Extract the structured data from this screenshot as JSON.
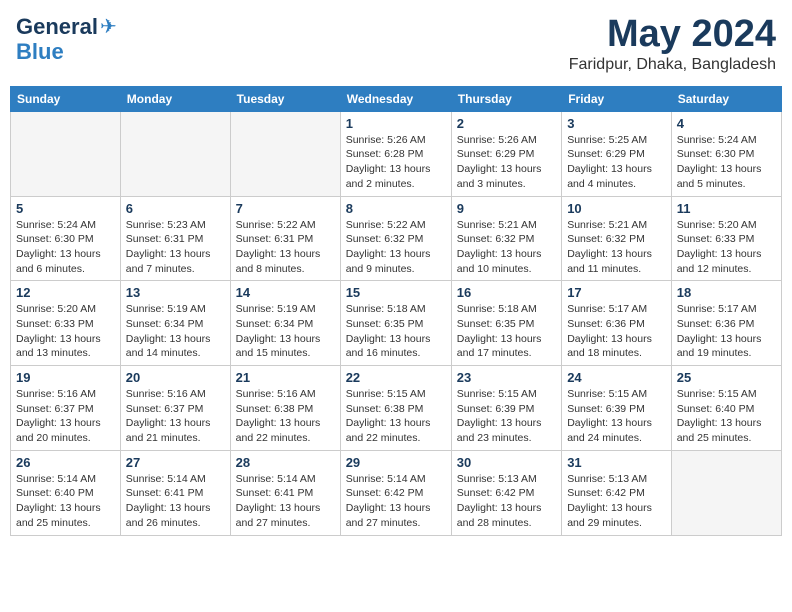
{
  "header": {
    "logo_general": "General",
    "logo_blue": "Blue",
    "month_year": "May 2024",
    "location": "Faridpur, Dhaka, Bangladesh"
  },
  "days_of_week": [
    "Sunday",
    "Monday",
    "Tuesday",
    "Wednesday",
    "Thursday",
    "Friday",
    "Saturday"
  ],
  "weeks": [
    [
      {
        "day": "",
        "info": ""
      },
      {
        "day": "",
        "info": ""
      },
      {
        "day": "",
        "info": ""
      },
      {
        "day": "1",
        "info": "Sunrise: 5:26 AM\nSunset: 6:28 PM\nDaylight: 13 hours\nand 2 minutes."
      },
      {
        "day": "2",
        "info": "Sunrise: 5:26 AM\nSunset: 6:29 PM\nDaylight: 13 hours\nand 3 minutes."
      },
      {
        "day": "3",
        "info": "Sunrise: 5:25 AM\nSunset: 6:29 PM\nDaylight: 13 hours\nand 4 minutes."
      },
      {
        "day": "4",
        "info": "Sunrise: 5:24 AM\nSunset: 6:30 PM\nDaylight: 13 hours\nand 5 minutes."
      }
    ],
    [
      {
        "day": "5",
        "info": "Sunrise: 5:24 AM\nSunset: 6:30 PM\nDaylight: 13 hours\nand 6 minutes."
      },
      {
        "day": "6",
        "info": "Sunrise: 5:23 AM\nSunset: 6:31 PM\nDaylight: 13 hours\nand 7 minutes."
      },
      {
        "day": "7",
        "info": "Sunrise: 5:22 AM\nSunset: 6:31 PM\nDaylight: 13 hours\nand 8 minutes."
      },
      {
        "day": "8",
        "info": "Sunrise: 5:22 AM\nSunset: 6:32 PM\nDaylight: 13 hours\nand 9 minutes."
      },
      {
        "day": "9",
        "info": "Sunrise: 5:21 AM\nSunset: 6:32 PM\nDaylight: 13 hours\nand 10 minutes."
      },
      {
        "day": "10",
        "info": "Sunrise: 5:21 AM\nSunset: 6:32 PM\nDaylight: 13 hours\nand 11 minutes."
      },
      {
        "day": "11",
        "info": "Sunrise: 5:20 AM\nSunset: 6:33 PM\nDaylight: 13 hours\nand 12 minutes."
      }
    ],
    [
      {
        "day": "12",
        "info": "Sunrise: 5:20 AM\nSunset: 6:33 PM\nDaylight: 13 hours\nand 13 minutes."
      },
      {
        "day": "13",
        "info": "Sunrise: 5:19 AM\nSunset: 6:34 PM\nDaylight: 13 hours\nand 14 minutes."
      },
      {
        "day": "14",
        "info": "Sunrise: 5:19 AM\nSunset: 6:34 PM\nDaylight: 13 hours\nand 15 minutes."
      },
      {
        "day": "15",
        "info": "Sunrise: 5:18 AM\nSunset: 6:35 PM\nDaylight: 13 hours\nand 16 minutes."
      },
      {
        "day": "16",
        "info": "Sunrise: 5:18 AM\nSunset: 6:35 PM\nDaylight: 13 hours\nand 17 minutes."
      },
      {
        "day": "17",
        "info": "Sunrise: 5:17 AM\nSunset: 6:36 PM\nDaylight: 13 hours\nand 18 minutes."
      },
      {
        "day": "18",
        "info": "Sunrise: 5:17 AM\nSunset: 6:36 PM\nDaylight: 13 hours\nand 19 minutes."
      }
    ],
    [
      {
        "day": "19",
        "info": "Sunrise: 5:16 AM\nSunset: 6:37 PM\nDaylight: 13 hours\nand 20 minutes."
      },
      {
        "day": "20",
        "info": "Sunrise: 5:16 AM\nSunset: 6:37 PM\nDaylight: 13 hours\nand 21 minutes."
      },
      {
        "day": "21",
        "info": "Sunrise: 5:16 AM\nSunset: 6:38 PM\nDaylight: 13 hours\nand 22 minutes."
      },
      {
        "day": "22",
        "info": "Sunrise: 5:15 AM\nSunset: 6:38 PM\nDaylight: 13 hours\nand 22 minutes."
      },
      {
        "day": "23",
        "info": "Sunrise: 5:15 AM\nSunset: 6:39 PM\nDaylight: 13 hours\nand 23 minutes."
      },
      {
        "day": "24",
        "info": "Sunrise: 5:15 AM\nSunset: 6:39 PM\nDaylight: 13 hours\nand 24 minutes."
      },
      {
        "day": "25",
        "info": "Sunrise: 5:15 AM\nSunset: 6:40 PM\nDaylight: 13 hours\nand 25 minutes."
      }
    ],
    [
      {
        "day": "26",
        "info": "Sunrise: 5:14 AM\nSunset: 6:40 PM\nDaylight: 13 hours\nand 25 minutes."
      },
      {
        "day": "27",
        "info": "Sunrise: 5:14 AM\nSunset: 6:41 PM\nDaylight: 13 hours\nand 26 minutes."
      },
      {
        "day": "28",
        "info": "Sunrise: 5:14 AM\nSunset: 6:41 PM\nDaylight: 13 hours\nand 27 minutes."
      },
      {
        "day": "29",
        "info": "Sunrise: 5:14 AM\nSunset: 6:42 PM\nDaylight: 13 hours\nand 27 minutes."
      },
      {
        "day": "30",
        "info": "Sunrise: 5:13 AM\nSunset: 6:42 PM\nDaylight: 13 hours\nand 28 minutes."
      },
      {
        "day": "31",
        "info": "Sunrise: 5:13 AM\nSunset: 6:42 PM\nDaylight: 13 hours\nand 29 minutes."
      },
      {
        "day": "",
        "info": ""
      }
    ]
  ]
}
